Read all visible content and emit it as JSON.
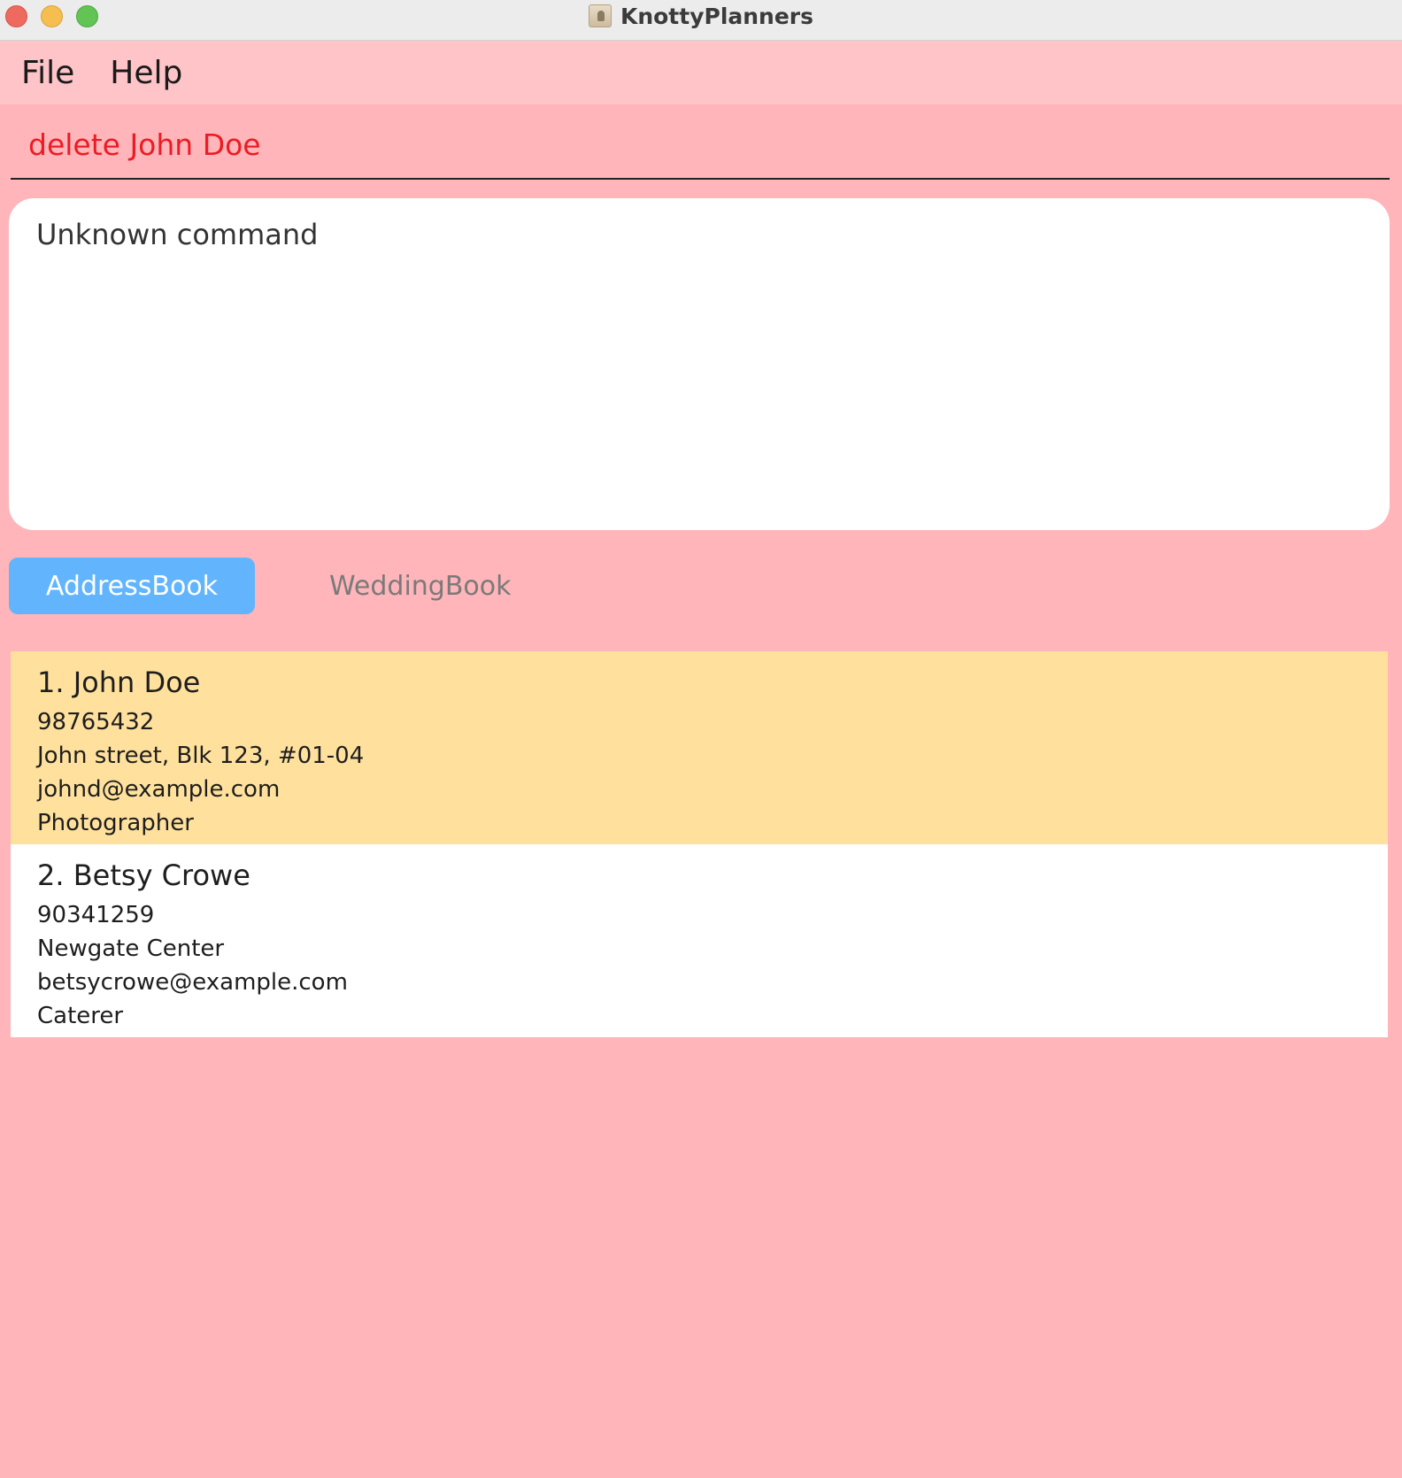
{
  "window": {
    "title": "KnottyPlanners"
  },
  "menu": {
    "items": [
      "File",
      "Help"
    ]
  },
  "command": {
    "value": "delete John Doe"
  },
  "result": {
    "message": "Unknown command"
  },
  "tabs": [
    {
      "label": "AddressBook",
      "active": true
    },
    {
      "label": "WeddingBook",
      "active": false
    }
  ],
  "persons": [
    {
      "name": "1. John Doe",
      "phone": "98765432",
      "address": "John street, Blk 123, #01-04",
      "email": "johnd@example.com",
      "role": "Photographer",
      "selected": true
    },
    {
      "name": "2. Betsy Crowe",
      "phone": "90341259",
      "address": "Newgate Center",
      "email": "betsycrowe@example.com",
      "role": "Caterer",
      "selected": false
    }
  ],
  "colors": {
    "background": "#ffb5b9",
    "menubar": "#ffc4c8",
    "command_text": "#ec1c24",
    "active_tab": "#62b5fd",
    "selected_card": "#ffe19d"
  }
}
